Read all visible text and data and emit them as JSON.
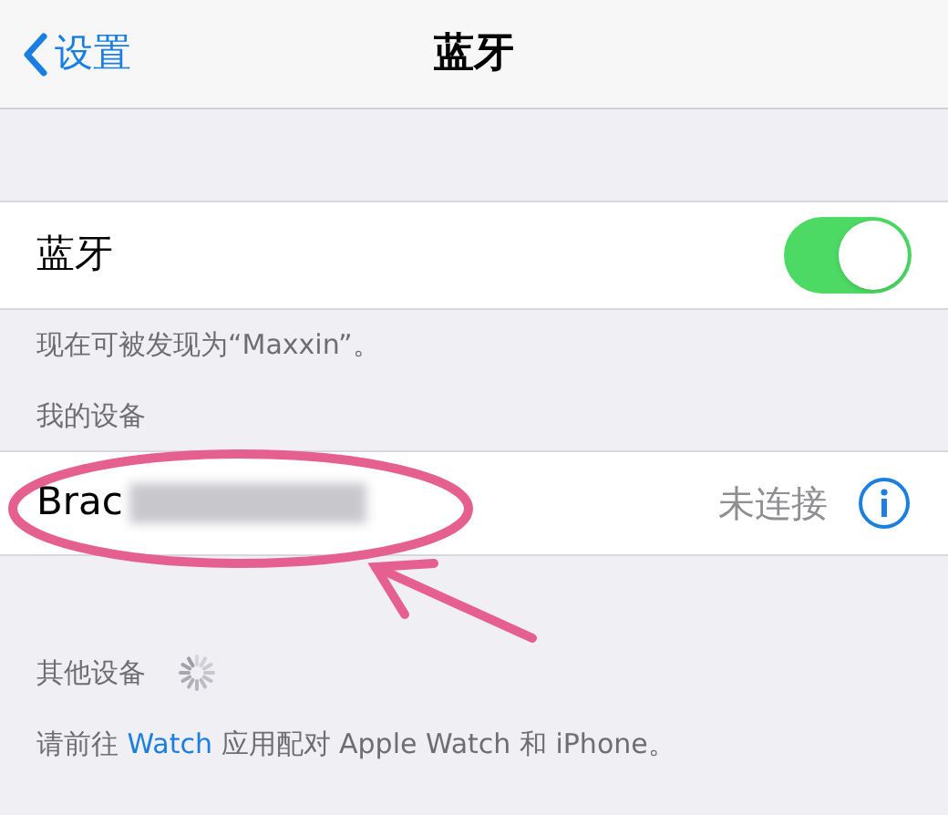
{
  "nav": {
    "back": "设置",
    "title": "蓝牙"
  },
  "bluetooth": {
    "label": "蓝牙",
    "on": true,
    "footer": "现在可被发现为“Maxxin”。"
  },
  "my_devices": {
    "header": "我的设备",
    "devices": [
      {
        "name": "Brac",
        "status": "未连接"
      }
    ]
  },
  "other_devices": {
    "header": "其他设备",
    "searching": true,
    "footer": {
      "before": "请前往 ",
      "link": "Watch",
      "after": " 应用配对 Apple Watch 和 iPhone。"
    }
  }
}
